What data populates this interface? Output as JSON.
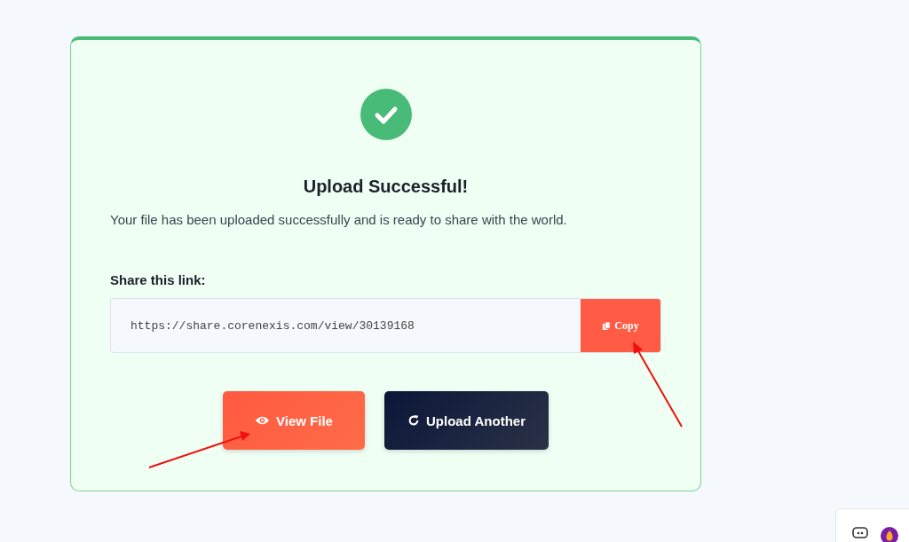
{
  "card": {
    "title": "Upload Successful!",
    "message": "Your file has been uploaded successfully and is ready to share with the world.",
    "share_label": "Share this link:",
    "share_link": {
      "value": "https://share.corenexis.com/view/30139168",
      "copy_button": "Copy"
    },
    "buttons": [
      {
        "label": "View File",
        "kind": "view"
      },
      {
        "label": "Upload Another",
        "kind": "upload"
      }
    ]
  }
}
